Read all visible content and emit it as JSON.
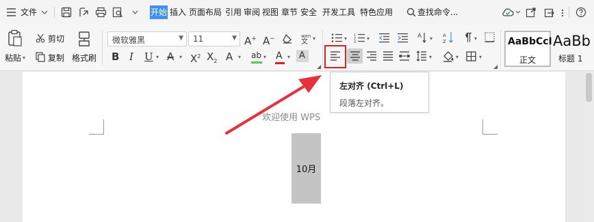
{
  "menubar": {
    "file_menu": "文件",
    "tabs": [
      {
        "label": "开始",
        "active": true
      },
      {
        "label": "插入"
      },
      {
        "label": "页面布局"
      },
      {
        "label": "引用"
      },
      {
        "label": "审阅"
      },
      {
        "label": "视图"
      },
      {
        "label": "章节"
      },
      {
        "label": "安全"
      },
      {
        "label": "开发工具"
      },
      {
        "label": "特色应用"
      }
    ],
    "search_label": "查找命令..."
  },
  "ribbon": {
    "paste_label": "粘贴",
    "cut_label": "剪切",
    "copy_label": "复制",
    "format_painter_label": "格式刷",
    "font_name": "微软雅黑",
    "font_size": "11",
    "styles": [
      {
        "sample": "AaBbCcI",
        "name": "正文"
      },
      {
        "sample": "AaBb",
        "name": "标题 1"
      }
    ]
  },
  "tooltip": {
    "title": "左对齐 (Ctrl+L)",
    "description": "段落左对齐。"
  },
  "document": {
    "header_text": "欢迎使用 WPS",
    "text_box_content": "10月"
  },
  "colors": {
    "accent": "#3f8ff6",
    "highlight": "#e02020",
    "arrow": "#e8303a"
  }
}
